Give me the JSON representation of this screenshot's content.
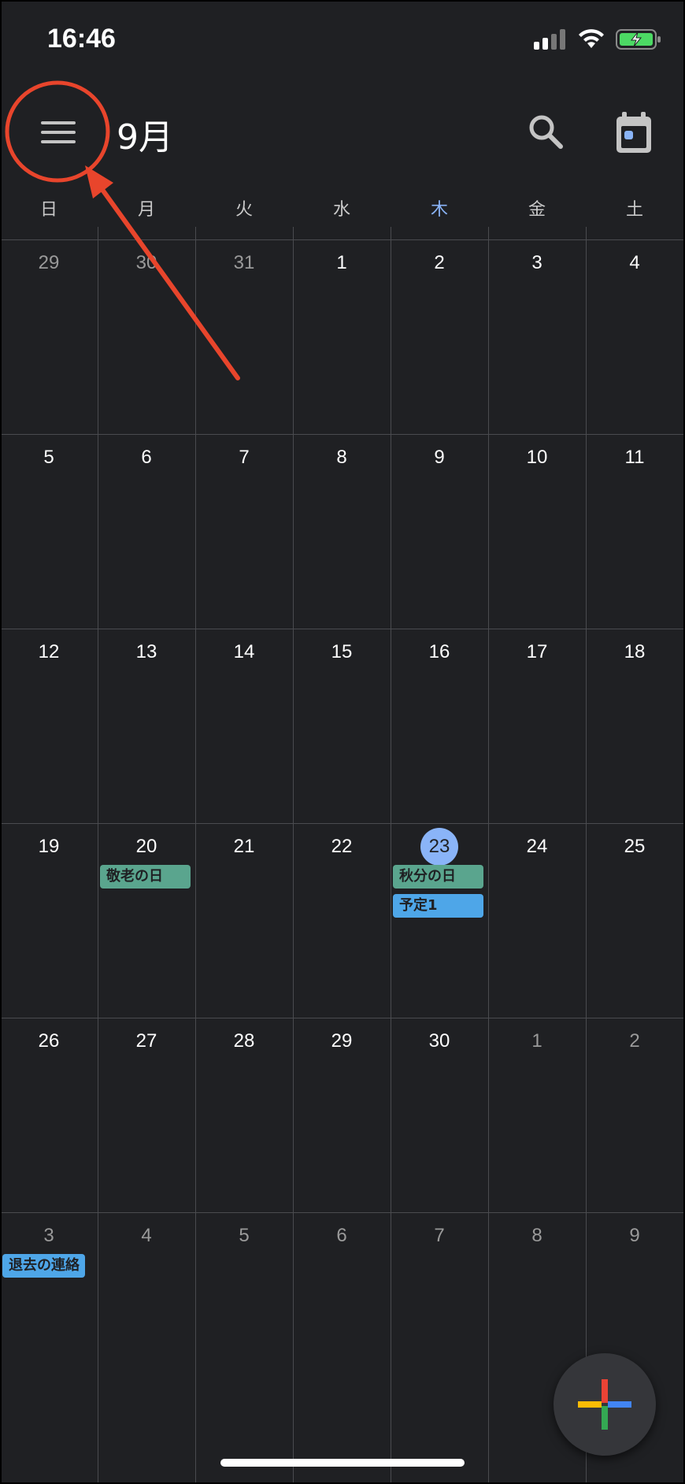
{
  "status_bar": {
    "time": "16:46"
  },
  "header": {
    "month_title": "9月"
  },
  "weekdays": [
    "日",
    "月",
    "火",
    "水",
    "木",
    "金",
    "土"
  ],
  "weeks": [
    [
      {
        "d": "29",
        "dim": true
      },
      {
        "d": "30",
        "dim": true
      },
      {
        "d": "31",
        "dim": true
      },
      {
        "d": "1"
      },
      {
        "d": "2"
      },
      {
        "d": "3"
      },
      {
        "d": "4"
      }
    ],
    [
      {
        "d": "5"
      },
      {
        "d": "6"
      },
      {
        "d": "7"
      },
      {
        "d": "8"
      },
      {
        "d": "9"
      },
      {
        "d": "10"
      },
      {
        "d": "11"
      }
    ],
    [
      {
        "d": "12"
      },
      {
        "d": "13"
      },
      {
        "d": "14"
      },
      {
        "d": "15"
      },
      {
        "d": "16"
      },
      {
        "d": "17"
      },
      {
        "d": "18"
      }
    ],
    [
      {
        "d": "19"
      },
      {
        "d": "20"
      },
      {
        "d": "21"
      },
      {
        "d": "22"
      },
      {
        "d": "23",
        "today": true
      },
      {
        "d": "24"
      },
      {
        "d": "25"
      }
    ],
    [
      {
        "d": "26"
      },
      {
        "d": "27"
      },
      {
        "d": "28"
      },
      {
        "d": "29"
      },
      {
        "d": "30"
      },
      {
        "d": "1",
        "dim": true
      },
      {
        "d": "2",
        "dim": true
      }
    ],
    [
      {
        "d": "3",
        "dim": true
      },
      {
        "d": "4",
        "dim": true
      },
      {
        "d": "5",
        "dim": true
      },
      {
        "d": "6",
        "dim": true
      },
      {
        "d": "7",
        "dim": true
      },
      {
        "d": "8",
        "dim": true
      },
      {
        "d": "9",
        "dim": true
      }
    ]
  ],
  "events": {
    "keiro": "敬老の日",
    "shubun": "秋分の日",
    "yotei": "予定1",
    "taikyo": "退去の連絡"
  },
  "colors": {
    "holiday": "#5aa58e",
    "event": "#4ea6e8",
    "today": "#8ab4f8",
    "annotation": "#e8452c"
  }
}
